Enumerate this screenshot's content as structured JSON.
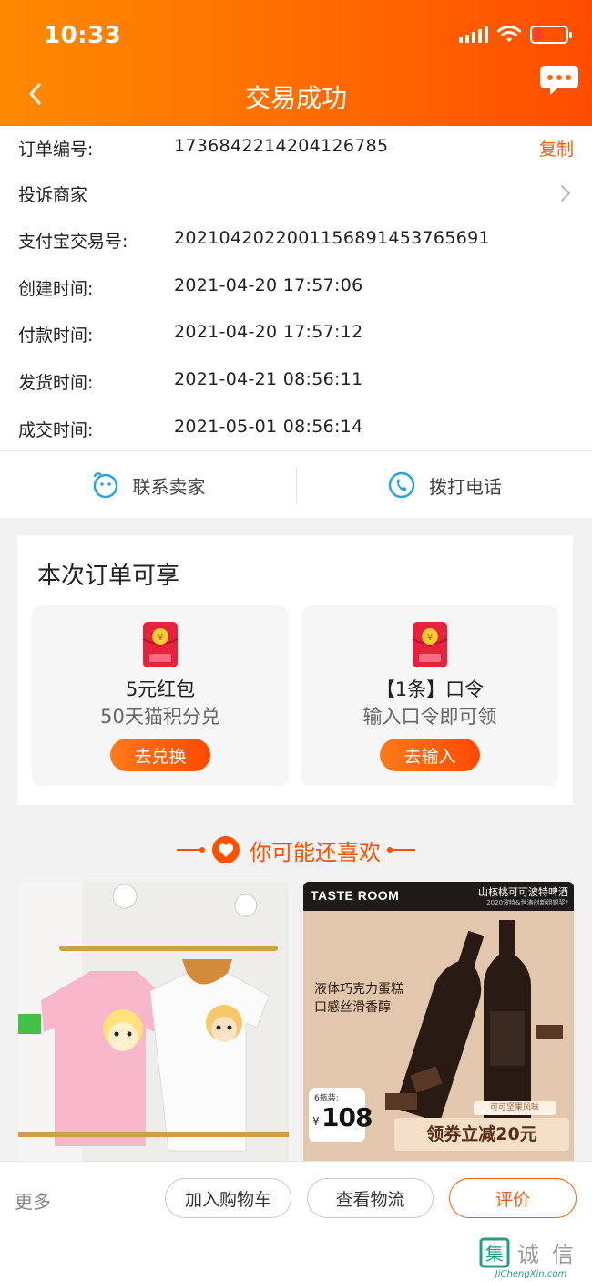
{
  "status_bar": {
    "time": "10:33"
  },
  "header": {
    "title": "交易成功"
  },
  "order_info": {
    "order_no_label": "订单编号:",
    "order_no": "1736842214204126785",
    "copy_label": "复制",
    "complaint_label": "投诉商家",
    "alipay_label": "支付宝交易号:",
    "alipay_no": "2021042022001156891453765691",
    "created_label": "创建时间:",
    "created": "2021-04-20 17:57:06",
    "paid_label": "付款时间:",
    "paid": "2021-04-20 17:57:12",
    "shipped_label": "发货时间:",
    "shipped": "2021-04-21 08:56:11",
    "completed_label": "成交时间:",
    "completed": "2021-05-01 08:56:14"
  },
  "contact": {
    "seller_label": "联系卖家",
    "phone_label": "拨打电话"
  },
  "benefits": {
    "title": "本次订单可享",
    "cards": [
      {
        "title": "5元红包",
        "subtitle": "50天猫积分兑",
        "button": "去兑换",
        "icon": "red-packet-icon"
      },
      {
        "title": "【1条】口令",
        "subtitle": "输入口令即可领",
        "button": "去输入",
        "icon": "red-packet-icon"
      }
    ]
  },
  "recommend": {
    "title": "你可能还喜欢"
  },
  "products": [
    {
      "image": "pink-white-tshirts-photo"
    },
    {
      "brand": "TASTE ROOM",
      "name": "山核桃可可波特啤酒",
      "award": "2020波特&世涛创新组铜奖*",
      "slogan1": "液体巧克力蛋糕",
      "slogan2": "口感丝滑香醇",
      "pack": "6瓶装:",
      "currency": "¥",
      "price": "108",
      "tag": "可可坚果风味",
      "coupon": "领券立减20元"
    }
  ],
  "bottom_bar": {
    "more": "更多",
    "add_cart": "加入购物车",
    "logistics": "查看物流",
    "rate": "评价"
  },
  "watermark": {
    "text": "JiChengXin.com",
    "chars": "集诚信"
  },
  "colors": {
    "accent": "#ff5a00",
    "header_start": "#ff8a00",
    "header_end": "#ff4d00",
    "contact_icon": "#2aa3e0"
  }
}
